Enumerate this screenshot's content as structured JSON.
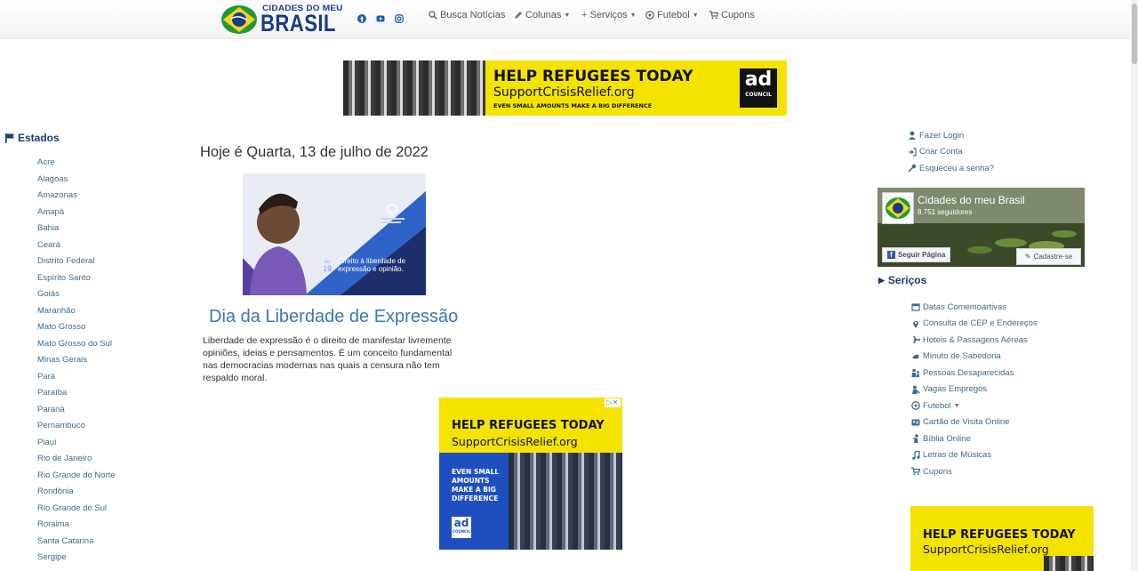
{
  "logo": {
    "top_text": "CIDADES DO MEU",
    "main_text": "BRASIL"
  },
  "social": [
    "facebook-icon",
    "youtube-icon",
    "instagram-icon"
  ],
  "nav": {
    "busca": "Busca Notícias",
    "colunas": "Colunas",
    "servicos": "+ Serviços",
    "futebol": "Futebol",
    "cupons": "Cupons"
  },
  "ad_top": {
    "headline": "HELP REFUGEES TODAY",
    "url": "SupportCrisisRelief.org",
    "sub": "EVEN SMALL AMOUNTS MAKE A BIG DIFFERENCE",
    "logo_top": "ad",
    "logo_bottom": "COUNCIL"
  },
  "estados": {
    "title": "Estados",
    "items": [
      "Acre",
      "Alagoas",
      "Amazonas",
      "Amapá",
      "Bahia",
      "Ceará",
      "Distrito Federal",
      "Espírito Santo",
      "Goiás",
      "Maranhão",
      "Mato Grosso",
      "Mato Grosso do Sul",
      "Minas Gerais",
      "Pará",
      "Paraíba",
      "Paraná",
      "Pernambuco",
      "Piauí",
      "Rio de Janeiro",
      "Rio Grande do Norte",
      "Rondônia",
      "Rio Grande do Sul",
      "Roraima",
      "Santa Catarina",
      "Sergipe"
    ]
  },
  "main": {
    "date": "Hoje é Quarta, 13 de julho de 2022",
    "image_number": "19",
    "image_caption": "Direito à liberdade de expressão e opinião.",
    "article_title": "Dia da Liberdade de Expressão",
    "article_text": "Liberdade de expressão é o direito de manifestar livremente opiniões, ideias e pensamentos. É um conceito fundamental nas democracias modernas nas quais a censura não tem respaldo moral."
  },
  "ad_middle": {
    "headline": "HELP REFUGEES TODAY",
    "url": "SupportCrisisRelief.org",
    "sub_lines": [
      "EVEN SMALL",
      "AMOUNTS",
      "MAKE A BIG",
      "DIFFERENCE"
    ],
    "logo_top": "ad",
    "logo_bottom": "COUNCIL"
  },
  "account": {
    "login": "Fazer Login",
    "create": "Criar Conta",
    "forgot": "Esqueceu a senha?"
  },
  "facebook": {
    "page_name": "Cidades do meu Brasil",
    "followers": "8.751 seguidores",
    "follow_button": "Seguir Página",
    "signup_button": "Cadastre-se"
  },
  "servicos": {
    "title": "Seriços",
    "items": [
      {
        "label": "Datas Comemoartivas",
        "icon": "calendar-icon"
      },
      {
        "label": "Consulta de CEP e Endereços",
        "icon": "map-marker-icon"
      },
      {
        "label": "Hoteis & Passagens Aéreas",
        "icon": "plane-icon"
      },
      {
        "label": "Minuto de Sabedoria",
        "icon": "dove-icon"
      },
      {
        "label": "Pessoas Desaparecidas",
        "icon": "people-icon"
      },
      {
        "label": "Vagas Empregos",
        "icon": "worker-icon"
      },
      {
        "label": "Futebol",
        "icon": "soccer-ball-icon"
      },
      {
        "label": "Cartão de Visita Online",
        "icon": "id-card-icon"
      },
      {
        "label": "Bíblia Online",
        "icon": "praying-icon"
      },
      {
        "label": "Letras de Músicas",
        "icon": "music-note-icon"
      },
      {
        "label": "Cupons",
        "icon": "cart-icon"
      }
    ]
  },
  "ad_right": {
    "headline": "HELP REFUGEES TODAY",
    "url": "SupportCrisisRelief.org"
  },
  "colors": {
    "link": "#3f6b8f",
    "title_blue": "#3a78b6",
    "heading_navy": "#1a3a6e",
    "ad_yellow": "#f4e300",
    "logo_blue": "#1a3a8a"
  }
}
